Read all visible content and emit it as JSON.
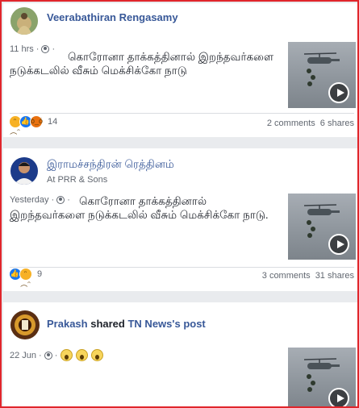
{
  "colors": {
    "frame": "#e0262c",
    "link": "#385898",
    "like": "#1877f2",
    "sad": "#f7b125",
    "angry": "#e9710f"
  },
  "posts": [
    {
      "author": "Veerabathiran Rengasamy",
      "time": "11 hrs",
      "text": "கொரோனா தாக்கத்தினால் இறந்தவர்களை நடுக்கடலில் வீசும் மெக்சிக்கோ நாடு",
      "reactions": [
        "sad-icon",
        "like-icon",
        "angry-icon"
      ],
      "reaction_count": "14",
      "comments": "2 comments",
      "shares": "6 shares"
    },
    {
      "author": "இராமச்சந்திரன் ரெத்தினம்",
      "subtitle": "At PRR & Sons",
      "time": "Yesterday",
      "text": "கொரோனா தாக்கத்தினால் இறந்தவர்களை நடுக்கடலில் வீசும் மெக்சிக்கோ நாடு.",
      "reactions": [
        "like-icon",
        "sad-icon"
      ],
      "reaction_count": "9",
      "comments": "3 comments",
      "shares": "31 shares"
    },
    {
      "author": "Prakash",
      "shared_word": "shared",
      "shared_source": "TN News's post",
      "time": "22 Jun",
      "emoji_count": 3
    }
  ]
}
